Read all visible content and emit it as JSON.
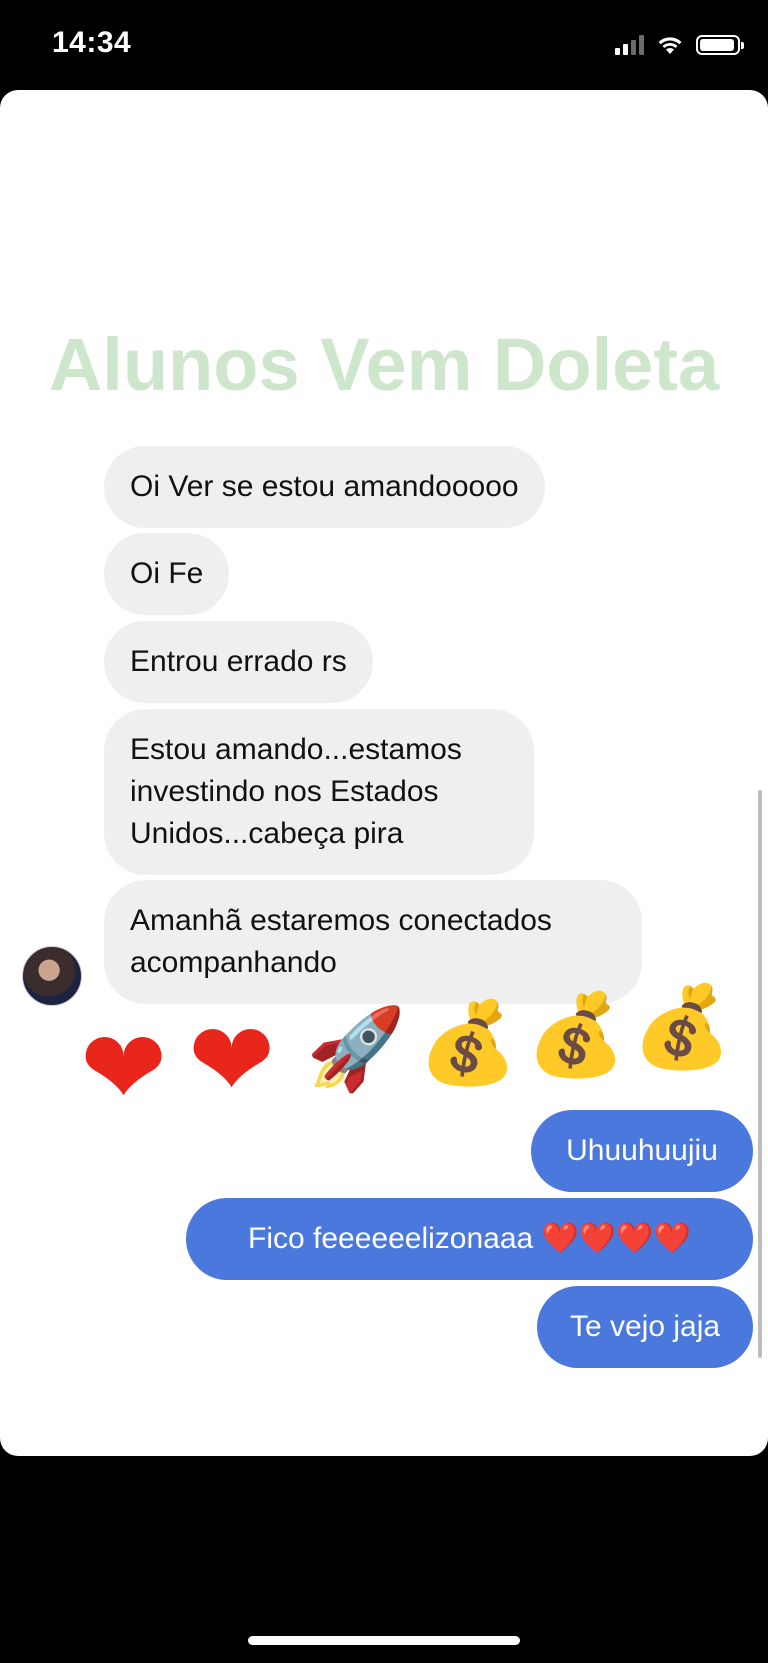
{
  "status_bar": {
    "time": "14:34",
    "icons": [
      "signal-icon",
      "wifi-icon",
      "battery-icon"
    ]
  },
  "watermark": "Alunos Vem Doleta",
  "messages": {
    "incoming": [
      "Oi Ver se estou amandooooo",
      "Oi Fe",
      "Entrou errado rs",
      "Estou amando...estamos investindo nos Estados Unidos...cabeça pira",
      "Amanhã estaremos conectados acompanhando"
    ],
    "outgoing": [
      "Uhuuhuujiu",
      "Fico feeeeeelizonaaa ❤️❤️❤️❤️",
      "Te vejo jaja"
    ]
  },
  "reaction_emojis": [
    "❤",
    "❤",
    "🚀",
    "💰",
    "💰",
    "💰"
  ],
  "colors": {
    "outgoing_bubble": "#4a78dc",
    "incoming_bubble": "#efefef",
    "watermark": "#cde6cc"
  }
}
